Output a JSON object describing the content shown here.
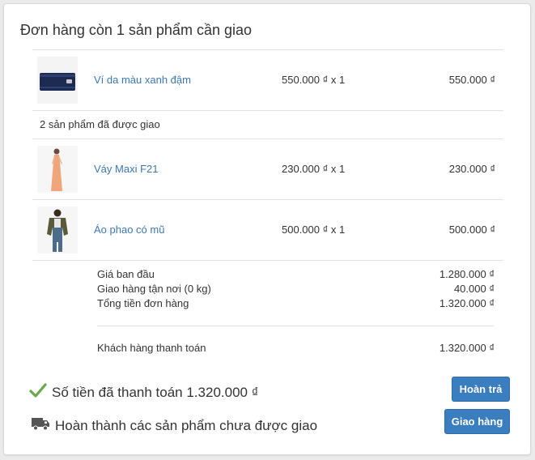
{
  "order": {
    "title": "Đơn hàng còn 1 sản phẩm cần giao",
    "pending_items": [
      {
        "name": "Ví da màu xanh đậm",
        "qty_price": "550.000 ₫ x 1",
        "total": "550.000 ₫",
        "image_icon": "wallet-image"
      }
    ],
    "delivered_label": "2 sản phẩm đã được giao",
    "delivered_items": [
      {
        "name": "Váy Maxi F21",
        "qty_price": "230.000 ₫ x 1",
        "total": "230.000 ₫",
        "image_icon": "dress-image"
      },
      {
        "name": "Áo phao có mũ",
        "qty_price": "500.000 ₫ x 1",
        "total": "500.000 ₫",
        "image_icon": "jacket-image"
      }
    ],
    "summary": {
      "subtotal_label": "Giá ban đầu",
      "subtotal_value": "1.280.000 ₫",
      "shipping_label": "Giao hàng tận nơi (0 kg)",
      "shipping_value": "40.000 ₫",
      "total_label": "Tổng tiền đơn hàng",
      "total_value": "1.320.000 ₫",
      "paid_label": "Khách hàng thanh toán",
      "paid_value": "1.320.000 ₫"
    },
    "payment_status": {
      "text": "Số tiền đã thanh toán 1.320.000 ₫",
      "icon": "check-icon",
      "button": "Hoàn trả"
    },
    "fulfillment_status": {
      "text": "Hoàn thành các sản phẩm chưa được giao",
      "icon": "truck-icon",
      "button": "Giao hàng"
    }
  },
  "colors": {
    "link": "#3c78b5",
    "button": "#3a7ec0",
    "check": "#6aa84f",
    "truck": "#555555"
  }
}
